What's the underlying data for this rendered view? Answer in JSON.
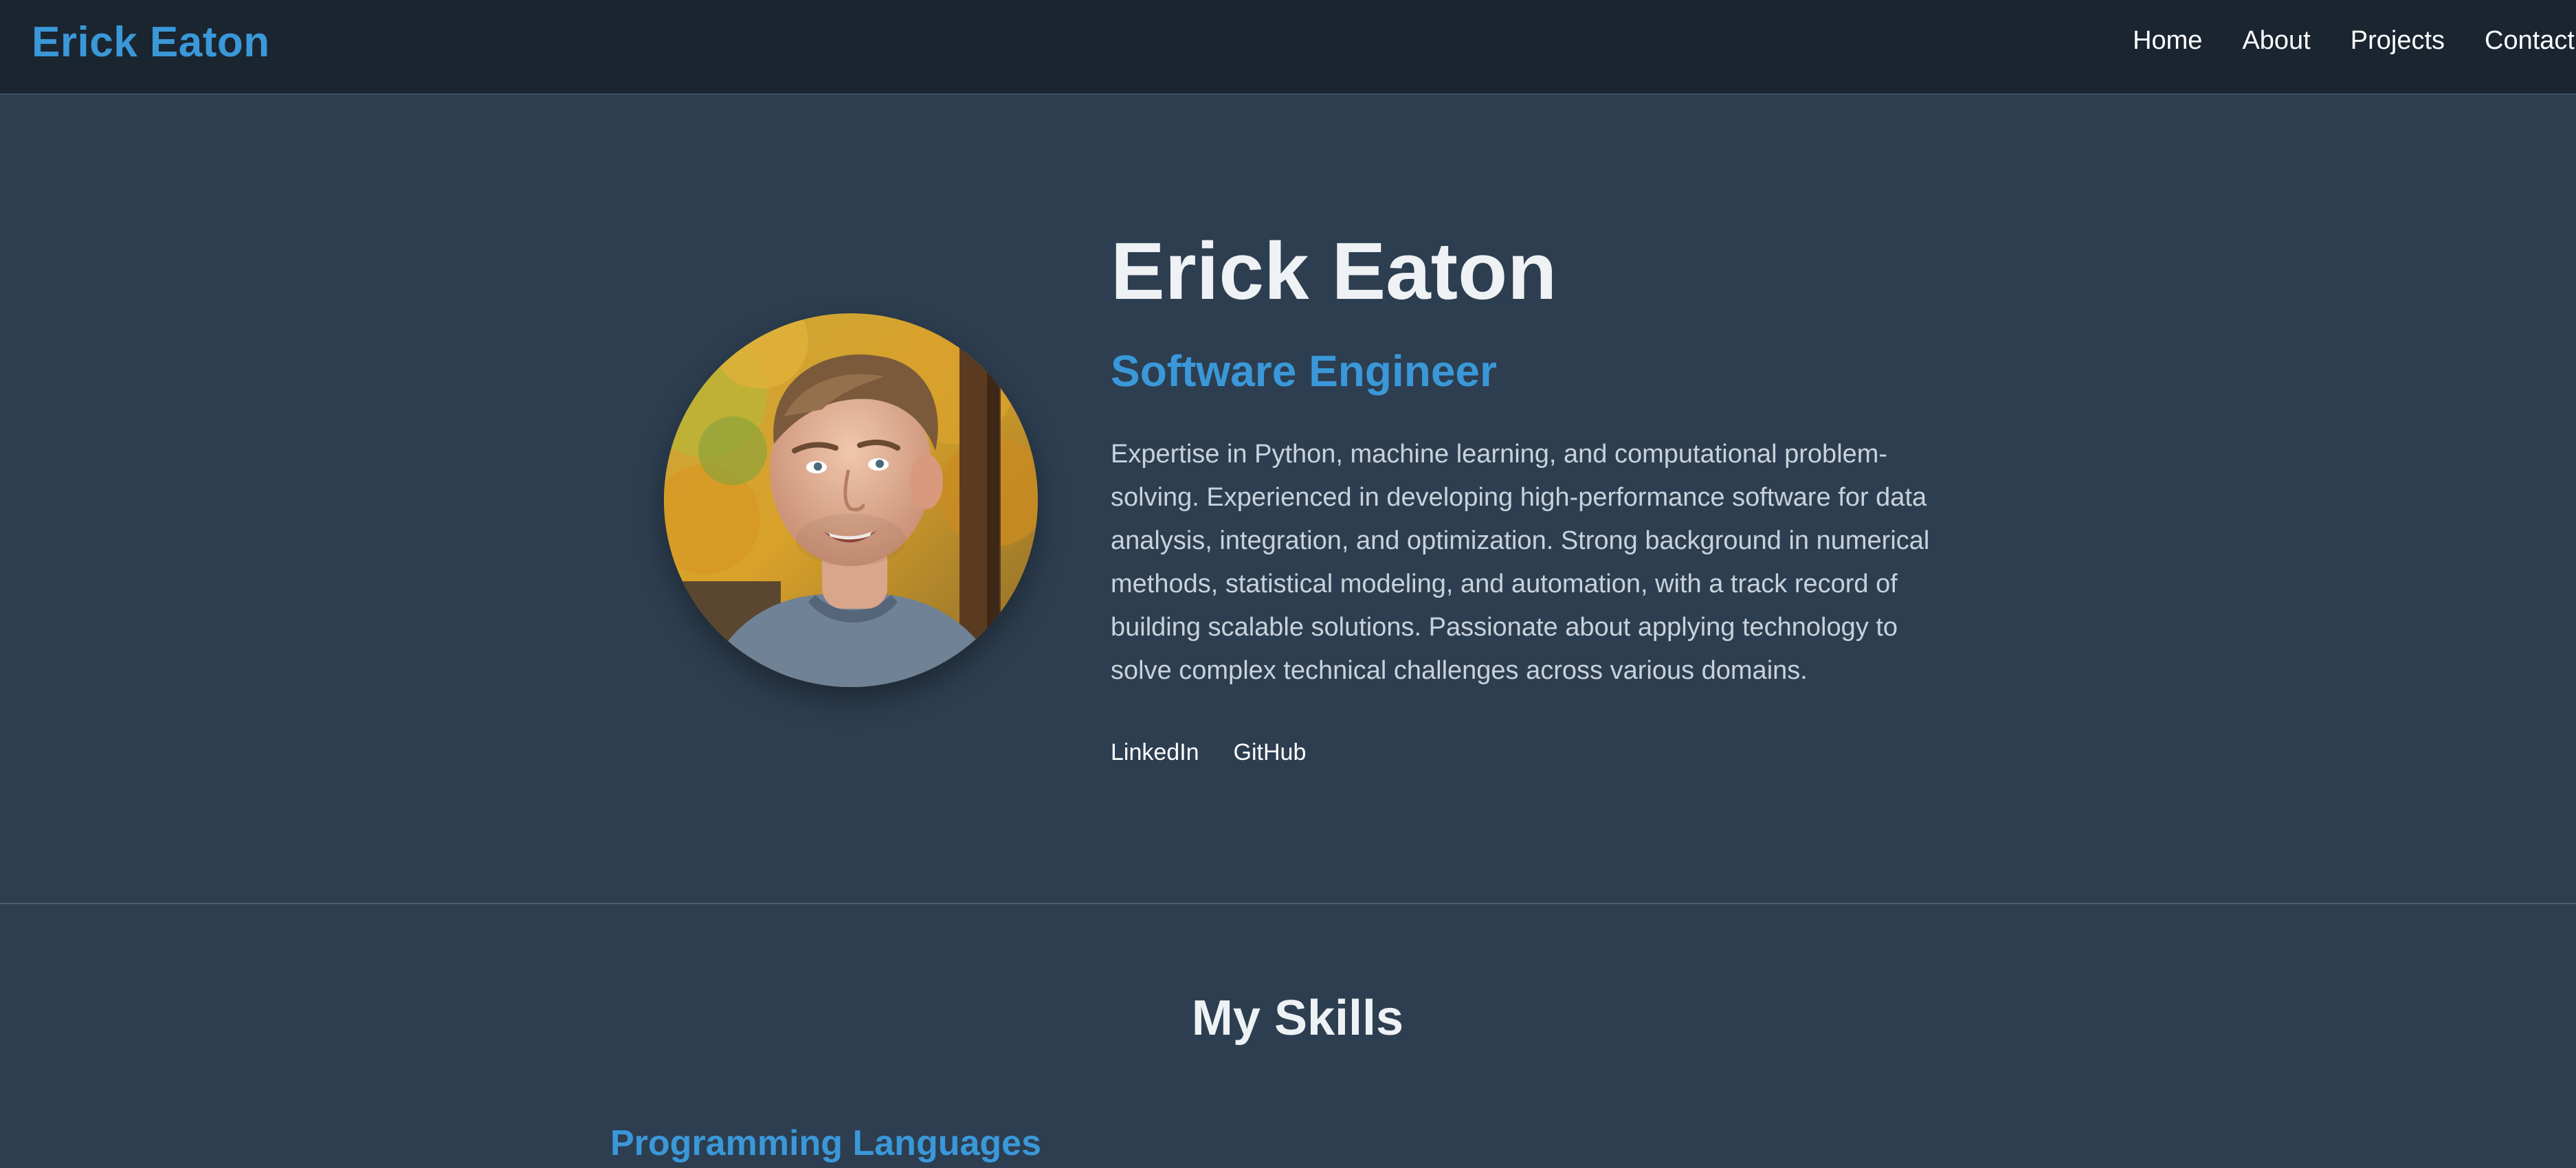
{
  "nav": {
    "brand": "Erick Eaton",
    "links": [
      "Home",
      "About",
      "Projects",
      "Contact"
    ]
  },
  "hero": {
    "name": "Erick Eaton",
    "role": "Software Engineer",
    "bio": "Expertise in Python, machine learning, and computational problem-solving. Experienced in developing high-performance software for data analysis, integration, and optimization. Strong background in numerical methods, statistical modeling, and automation, with a track record of building scalable solutions. Passionate about applying technology to solve complex technical challenges across various domains.",
    "links": [
      "LinkedIn",
      "GitHub"
    ]
  },
  "skills": {
    "title": "My Skills",
    "categories": [
      "Programming Languages"
    ]
  },
  "colors": {
    "accent": "#3a98d9",
    "background": "#2d3e50",
    "navbar": "#1b2530",
    "heading": "#eef2f5",
    "body_text": "#c8d2dc"
  }
}
